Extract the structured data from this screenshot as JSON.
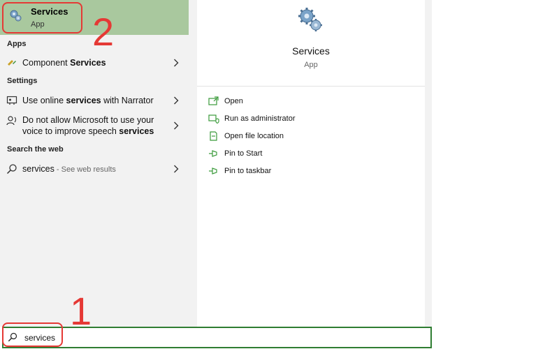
{
  "top_result": {
    "title": "Services",
    "subtitle": "App"
  },
  "sections": {
    "apps": "Apps",
    "settings": "Settings",
    "web": "Search the web"
  },
  "results": {
    "component_services": {
      "prefix": "Component ",
      "bold": "Services"
    },
    "narrator": {
      "prefix": "Use online ",
      "bold": "services",
      "suffix": " with Narrator"
    },
    "speech": {
      "line1": "Do not allow Microsoft to use your",
      "line2_prefix": "voice to improve speech ",
      "line2_bold": "services"
    },
    "web_search": {
      "query": "services",
      "hint": " - See web results"
    }
  },
  "detail": {
    "title": "Services",
    "subtitle": "App",
    "actions": [
      {
        "label": "Open",
        "icon": "open-icon"
      },
      {
        "label": "Run as administrator",
        "icon": "shield-icon"
      },
      {
        "label": "Open file location",
        "icon": "file-icon"
      },
      {
        "label": "Pin to Start",
        "icon": "pin-icon"
      },
      {
        "label": "Pin to taskbar",
        "icon": "pin-icon"
      }
    ]
  },
  "search": {
    "value": "services"
  },
  "annotations": {
    "step1": "1",
    "step2": "2"
  },
  "colors": {
    "accent": "#2f7d32",
    "highlight": "#a9c89e",
    "annotation": "#e53935"
  }
}
